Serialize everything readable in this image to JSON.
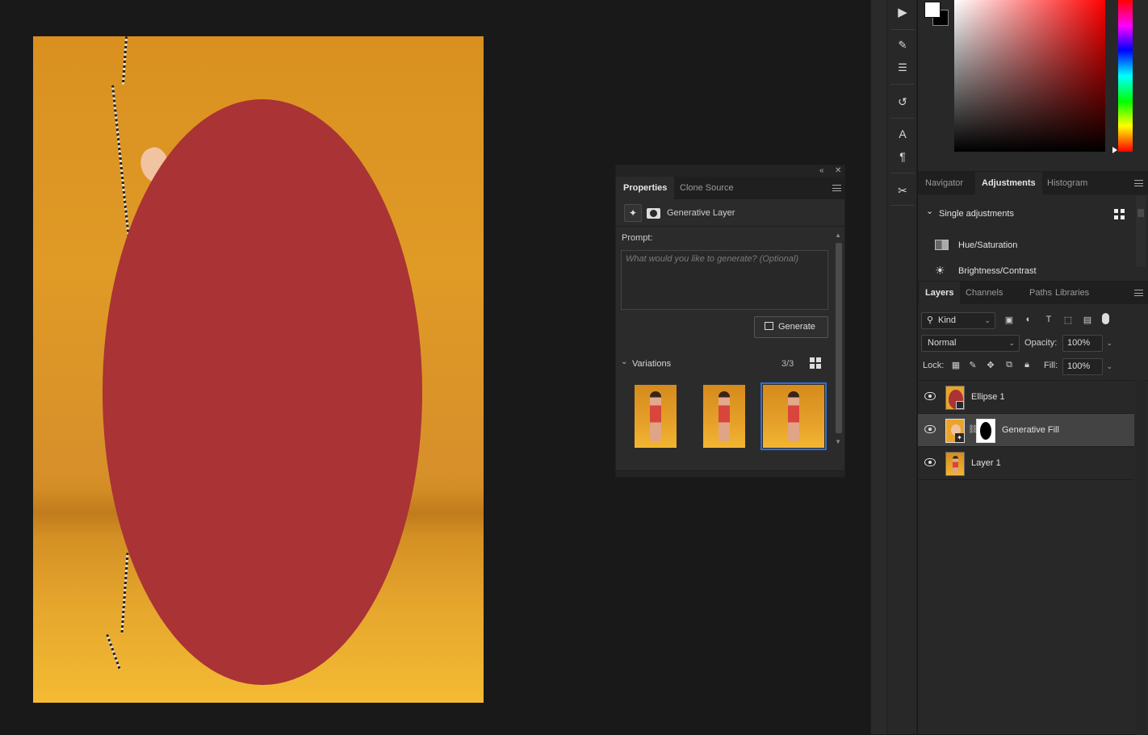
{
  "properties_panel": {
    "tabs": [
      "Properties",
      "Clone Source"
    ],
    "active_tab": "Properties",
    "layer_kind_label": "Generative Layer",
    "prompt_label": "Prompt:",
    "prompt_placeholder": "What would you like to generate? (Optional)",
    "prompt_value": "",
    "generate_label": "Generate",
    "variations_label": "Variations",
    "variations_count": "3/3",
    "selected_variation": 3
  },
  "adjustments_panel": {
    "tabs": [
      "Navigator",
      "Adjustments",
      "Histogram"
    ],
    "active_tab": "Adjustments",
    "section_label": "Single adjustments",
    "items": [
      "Hue/Saturation",
      "Brightness/Contrast"
    ]
  },
  "layers_panel": {
    "tabs": [
      "Layers",
      "Channels",
      "Paths",
      "Libraries"
    ],
    "active_tab": "Layers",
    "filter_kind": "Kind",
    "blend_mode": "Normal",
    "opacity_label": "Opacity:",
    "opacity_value": "100%",
    "lock_label": "Lock:",
    "fill_label": "Fill:",
    "fill_value": "100%",
    "layers": [
      {
        "name": "Ellipse 1",
        "visible": true,
        "selected": false
      },
      {
        "name": "Generative Fill",
        "visible": true,
        "selected": true
      },
      {
        "name": "Layer 1",
        "visible": true,
        "selected": false
      }
    ]
  },
  "colors": {
    "foreground": "#ffffff",
    "background": "#000000",
    "ellipse_fill": "#a93335",
    "selection_accent": "#2f6fd6"
  },
  "icons": {
    "tool_strip": [
      "play-icon",
      "brush-settings-icon",
      "adjust-sliders-icon",
      "history-icon",
      "character-icon",
      "paragraph-icon",
      "tools-icon"
    ]
  }
}
